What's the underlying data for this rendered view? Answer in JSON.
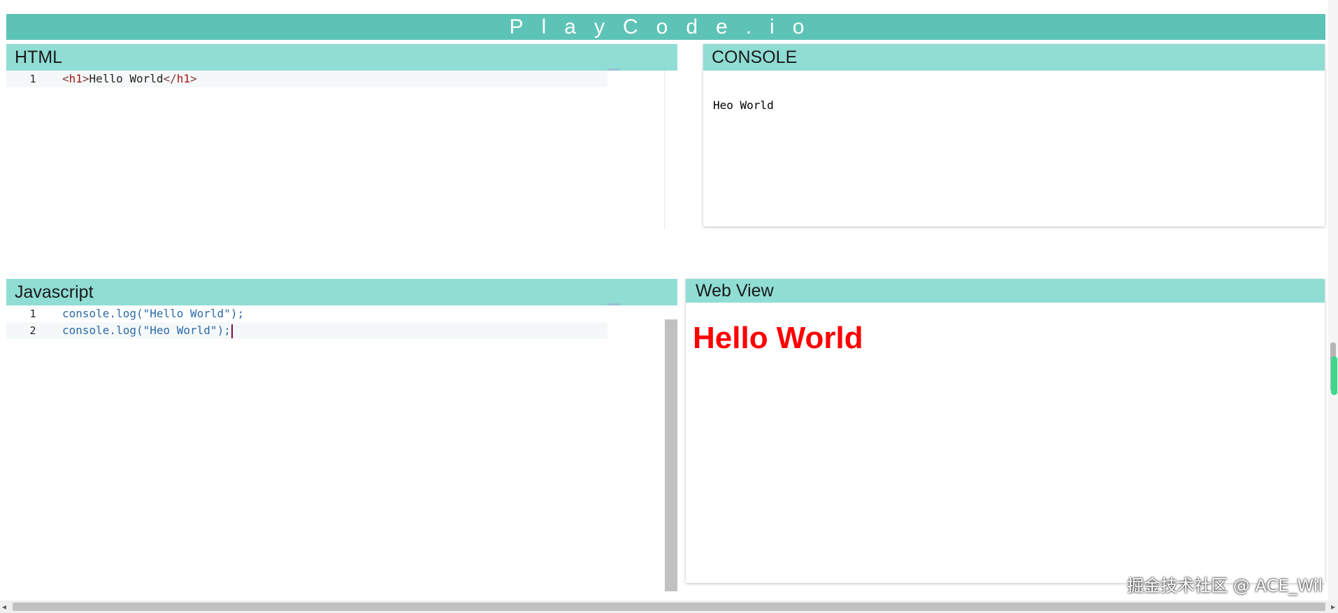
{
  "app": {
    "title": "PlayCode.io"
  },
  "panels": {
    "html": {
      "label": "HTML",
      "lines": [
        {
          "num": "1",
          "open_lt": "<",
          "open_tag": "h1",
          "open_gt": ">",
          "content": "Hello World",
          "close_lt": "</",
          "close_tag": "h1",
          "close_gt": ">"
        }
      ]
    },
    "console": {
      "label": "CONSOLE",
      "output": "Heo World"
    },
    "javascript": {
      "label": "Javascript",
      "lines": [
        {
          "num": "1",
          "fn": "console.log(",
          "str": "\"Hello World\"",
          "end": ");"
        },
        {
          "num": "2",
          "fn": "console.log(",
          "str": "\"Heo World\"",
          "end": ");"
        }
      ]
    },
    "webview": {
      "label": "Web View",
      "h1": "Hello World"
    }
  },
  "watermark": "掘金技术社区 @ ACE_Wil",
  "scrollbar": {
    "left_arrow": "◂",
    "right_arrow": "▸"
  },
  "colors": {
    "title_bar": "#5ec3b7",
    "panel_header": "#90ddd4",
    "webview_heading": "#ff0000"
  },
  "icons": {
    "cursor": "text-cursor"
  }
}
